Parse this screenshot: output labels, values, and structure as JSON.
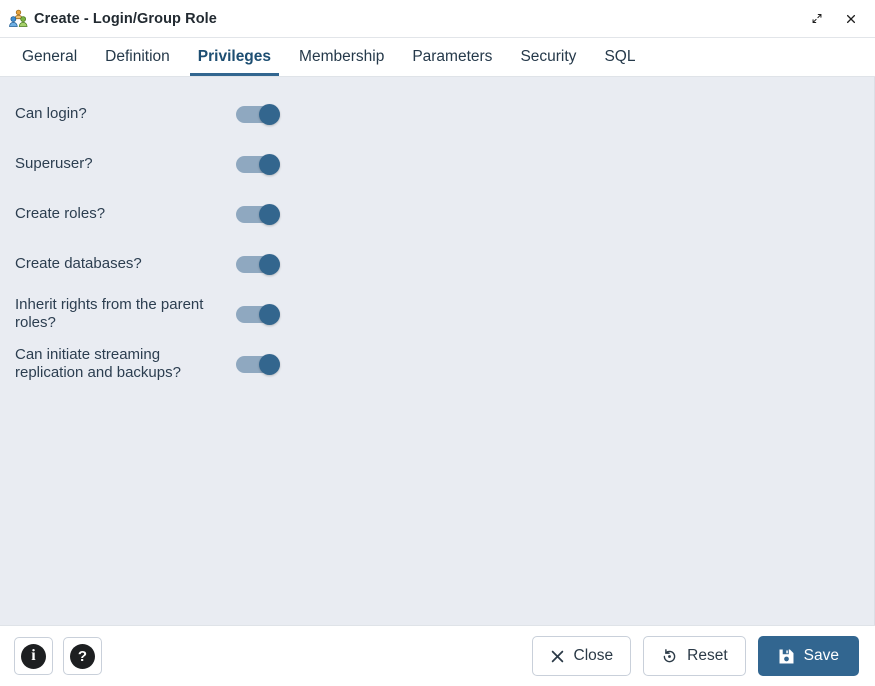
{
  "window": {
    "title": "Create - Login/Group Role",
    "icon": "login-group-role-icon",
    "expand_icon": "expand-diagonal-icon",
    "close_icon": "close-icon"
  },
  "tabs": [
    {
      "label": "General",
      "active": false
    },
    {
      "label": "Definition",
      "active": false
    },
    {
      "label": "Privileges",
      "active": true
    },
    {
      "label": "Membership",
      "active": false
    },
    {
      "label": "Parameters",
      "active": false
    },
    {
      "label": "Security",
      "active": false
    },
    {
      "label": "SQL",
      "active": false
    }
  ],
  "privileges": [
    {
      "label": "Can login?",
      "value": "on"
    },
    {
      "label": "Superuser?",
      "value": "on"
    },
    {
      "label": "Create roles?",
      "value": "on"
    },
    {
      "label": "Create databases?",
      "value": "on"
    },
    {
      "label": "Inherit rights from the parent roles?",
      "value": "on"
    },
    {
      "label": "Can initiate streaming replication and backups?",
      "value": "on"
    }
  ],
  "footer": {
    "info_icon": "info-icon",
    "help_icon": "help-icon",
    "close_label": "Close",
    "reset_label": "Reset",
    "save_label": "Save"
  },
  "colors": {
    "accent": "#326690",
    "toggle_track": "#8fa8c0",
    "toggle_knob": "#33668e",
    "body_background": "#e9ecf2",
    "text": "#2c3e50"
  }
}
